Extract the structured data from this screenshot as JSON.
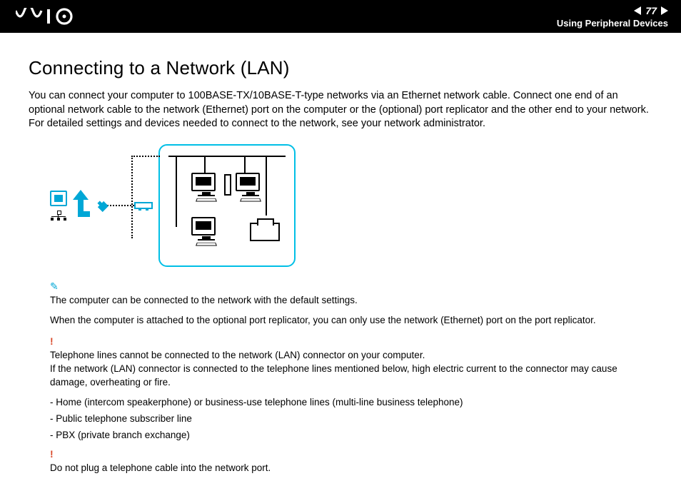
{
  "header": {
    "logo_alt": "VAIO",
    "page_number": "77",
    "section": "Using Peripheral Devices"
  },
  "title": "Connecting to a Network (LAN)",
  "intro": "You can connect your computer to 100BASE-TX/10BASE-T-type networks via an Ethernet network cable. Connect one end of an optional network cable to the network (Ethernet) port on the computer or the (optional) port replicator and the other end to your network. For detailed settings and devices needed to connect to the network, see your network administrator.",
  "notes": {
    "n1": "The computer can be connected to the network with the default settings.",
    "n2": "When the computer is attached to the optional port replicator, you can only use the network (Ethernet) port on the port replicator."
  },
  "warnings": {
    "w1a": "Telephone lines cannot be connected to the network (LAN) connector on your computer.",
    "w1b": "If the network (LAN) connector is connected to the telephone lines mentioned below, high electric current to the connector may cause damage, overheating or fire.",
    "w2": "Do not plug a telephone cable into the network port."
  },
  "bullets": {
    "b1": "Home (intercom speakerphone) or business-use telephone lines (multi-line business telephone)",
    "b2": "Public telephone subscriber line",
    "b3": "PBX (private branch exchange)"
  }
}
